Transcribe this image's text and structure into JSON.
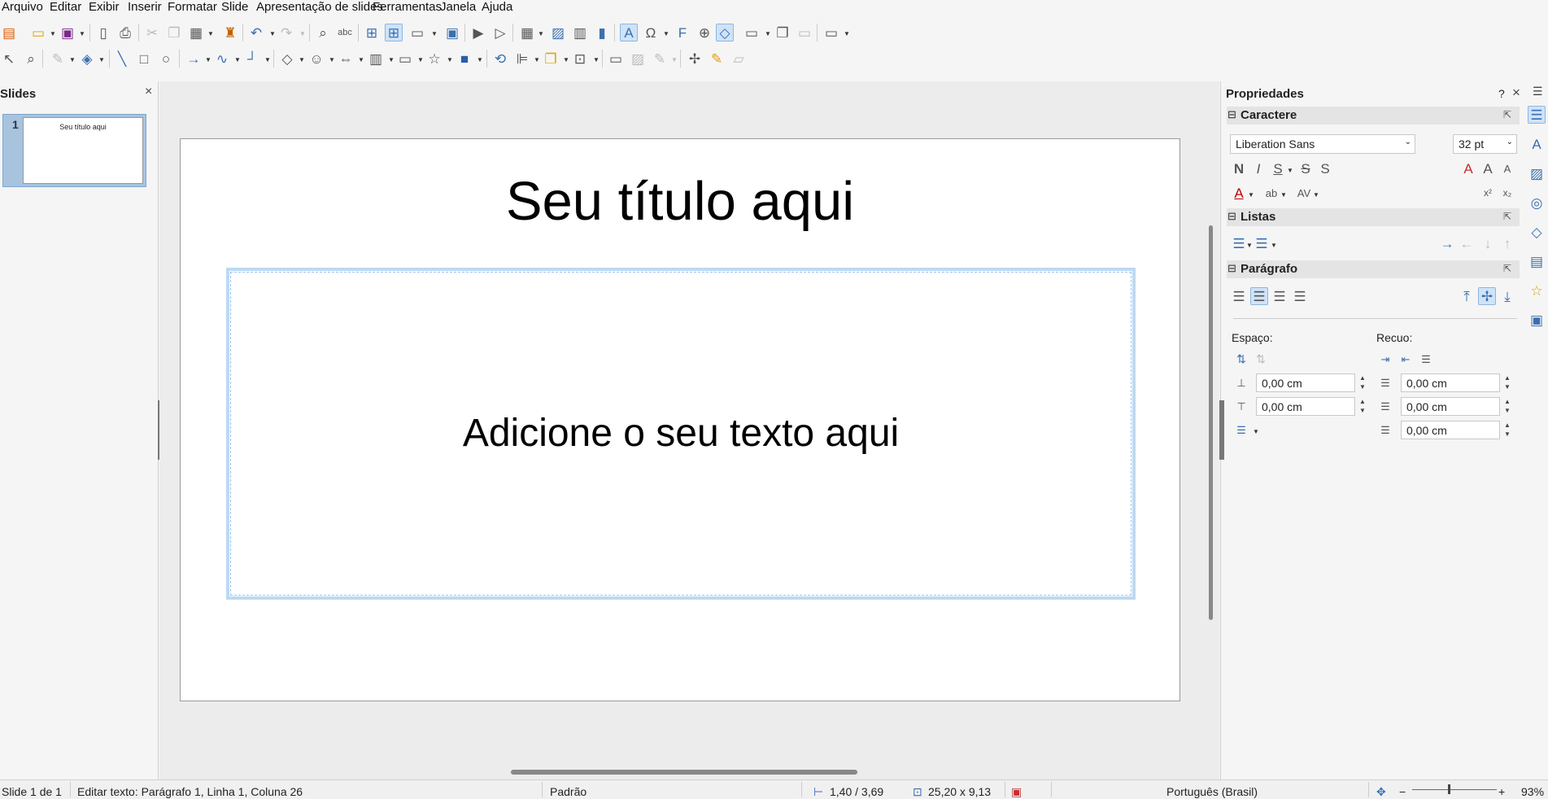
{
  "menu": [
    "Arquivo",
    "Editar",
    "Exibir",
    "Inserir",
    "Formatar",
    "Slide",
    "Apresentação de slides",
    "Ferramentas",
    "Janela",
    "Ajuda"
  ],
  "slides_pane": {
    "title": "Slides",
    "thumb_number": "1",
    "thumb_text": "Seu título aqui"
  },
  "slide": {
    "title": "Seu título aqui",
    "body": "Adicione o seu texto aqui"
  },
  "sidebar": {
    "title": "Propriedades",
    "help": "?",
    "caractere": {
      "label": "Caractere",
      "font": "Liberation Sans",
      "size": "32 pt"
    },
    "listas": {
      "label": "Listas"
    },
    "paragrafo": {
      "label": "Parágrafo",
      "espaco_label": "Espaço:",
      "recuo_label": "Recuo:",
      "above": "0,00 cm",
      "below": "0,00 cm",
      "indent_before": "0,00 cm",
      "indent_after": "0,00 cm",
      "first_line": "0,00 cm"
    }
  },
  "status": {
    "slide": "Slide 1 de 1",
    "edit": "Editar texto: Parágrafo 1, Linha 1, Coluna 26",
    "layout": "Padrão",
    "position": "1,40 / 3,69",
    "size": "25,20 x 9,13",
    "language": "Português (Brasil)",
    "zoom": "93%"
  },
  "colors": {
    "accent": "#3a6fb0",
    "selection": "#bcd9f3"
  }
}
